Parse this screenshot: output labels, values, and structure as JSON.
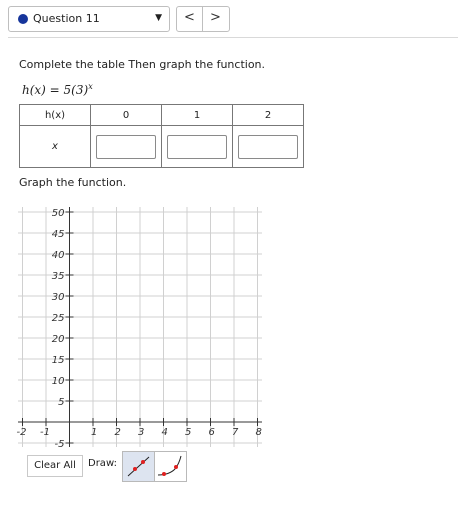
{
  "header": {
    "question_label": "Question 11",
    "prev_label": "<",
    "next_label": ">"
  },
  "instructions": "Complete the table Then graph the function.",
  "formula": {
    "lhs": "h(x) = 5(3)",
    "exponent": "x"
  },
  "table": {
    "row1_label": "h(x)",
    "row2_label": "x",
    "columns": [
      "0",
      "1",
      "2"
    ],
    "inputs": [
      "",
      "",
      ""
    ]
  },
  "graph_title": "Graph the function.",
  "graph": {
    "x_ticks": [
      "-2",
      "-1",
      "1",
      "2",
      "3",
      "4",
      "5",
      "6",
      "7",
      "8"
    ],
    "y_ticks": [
      "50",
      "45",
      "40",
      "35",
      "30",
      "25",
      "20",
      "15",
      "10",
      "5",
      "-5"
    ]
  },
  "tools": {
    "clear_label": "Clear All",
    "draw_label": "Draw:",
    "line_tool": "line-tool-icon",
    "exponential_tool": "exponential-tool-icon"
  },
  "colors": {
    "accent": "#16359b",
    "point": "#e02020",
    "selected_tool_bg": "#dde4f0"
  }
}
